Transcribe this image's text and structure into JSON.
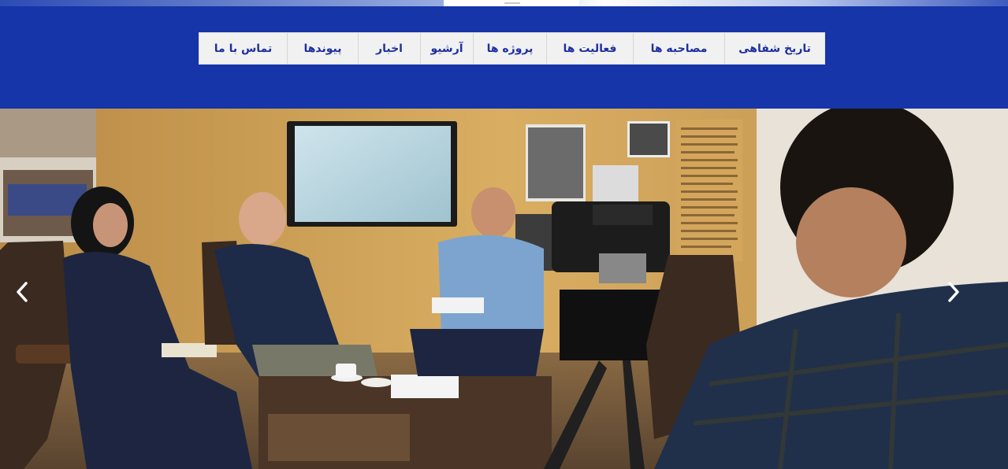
{
  "nav": {
    "items": [
      {
        "id": "oral-history",
        "label": "تاریخ شفاهی"
      },
      {
        "id": "interviews",
        "label": "مصاحبه ها"
      },
      {
        "id": "activities",
        "label": "فعالیت ها"
      },
      {
        "id": "projects",
        "label": "پروژه ها"
      },
      {
        "id": "archive",
        "label": "آرشیو"
      },
      {
        "id": "news",
        "label": "اخبار"
      },
      {
        "id": "links",
        "label": "پیوندها"
      },
      {
        "id": "contact",
        "label": "تماس با ما"
      }
    ]
  },
  "slider": {
    "prev_icon": "chevron-left-icon",
    "next_icon": "chevron-right-icon",
    "image_subject": "tv-studio-interview-photo"
  },
  "colors": {
    "header_bg": "#1535a8",
    "nav_bg": "#f1f1f1",
    "nav_text": "#1d2fa0"
  }
}
